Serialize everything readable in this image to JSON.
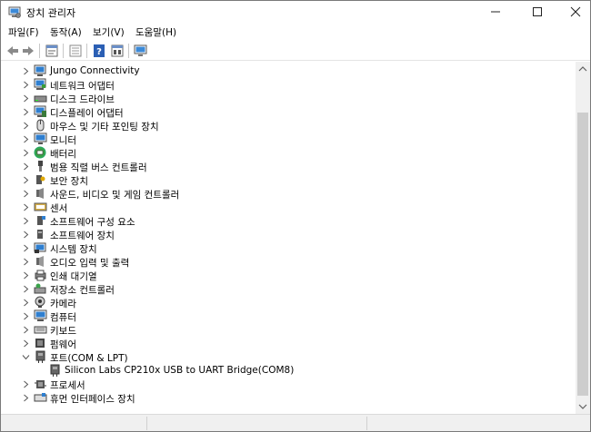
{
  "window": {
    "title": "장치 관리자",
    "controls": {
      "minimize": "—",
      "maximize": "☐",
      "close": "✕"
    }
  },
  "menubar": [
    {
      "label": "파일(F)"
    },
    {
      "label": "동작(A)"
    },
    {
      "label": "보기(V)"
    },
    {
      "label": "도움말(H)"
    }
  ],
  "toolbar": [
    {
      "icon": "back-arrow-icon"
    },
    {
      "icon": "forward-arrow-icon"
    },
    {
      "icon": "properties-icon"
    },
    {
      "icon": "show-hidden-icon"
    },
    {
      "icon": "help-icon"
    },
    {
      "icon": "update-driver-icon"
    },
    {
      "icon": "scan-hardware-icon"
    }
  ],
  "tree": [
    {
      "label": "Jungo Connectivity",
      "icon": "monitor-network-icon",
      "expanded": false
    },
    {
      "label": "네트워크 어댑터",
      "icon": "network-adapter-icon",
      "expanded": false
    },
    {
      "label": "디스크 드라이브",
      "icon": "disk-drive-icon",
      "expanded": false
    },
    {
      "label": "디스플레이 어댑터",
      "icon": "display-adapter-icon",
      "expanded": false
    },
    {
      "label": "마우스 및 기타 포인팅 장치",
      "icon": "mouse-icon",
      "expanded": false
    },
    {
      "label": "모니터",
      "icon": "monitor-icon",
      "expanded": false
    },
    {
      "label": "배터리",
      "icon": "battery-icon",
      "expanded": false
    },
    {
      "label": "범용 직렬 버스 컨트롤러",
      "icon": "usb-icon",
      "expanded": false
    },
    {
      "label": "보안 장치",
      "icon": "security-key-icon",
      "expanded": false
    },
    {
      "label": "사운드, 비디오 및 게임 컨트롤러",
      "icon": "speaker-icon",
      "expanded": false
    },
    {
      "label": "센서",
      "icon": "sensor-icon",
      "expanded": false
    },
    {
      "label": "소프트웨어 구성 요소",
      "icon": "software-component-icon",
      "expanded": false
    },
    {
      "label": "소프트웨어 장치",
      "icon": "software-device-icon",
      "expanded": false
    },
    {
      "label": "시스템 장치",
      "icon": "system-device-icon",
      "expanded": false
    },
    {
      "label": "오디오 입력 및 출력",
      "icon": "audio-icon",
      "expanded": false
    },
    {
      "label": "인쇄 대기열",
      "icon": "printer-icon",
      "expanded": false
    },
    {
      "label": "저장소 컨트롤러",
      "icon": "storage-controller-icon",
      "expanded": false
    },
    {
      "label": "카메라",
      "icon": "camera-icon",
      "expanded": false
    },
    {
      "label": "컴퓨터",
      "icon": "computer-icon",
      "expanded": false
    },
    {
      "label": "키보드",
      "icon": "keyboard-icon",
      "expanded": false
    },
    {
      "label": "펌웨어",
      "icon": "firmware-icon",
      "expanded": false
    },
    {
      "label": "포트(COM & LPT)",
      "icon": "port-icon",
      "expanded": true
    },
    {
      "label": "Silicon Labs CP210x USB to UART Bridge(COM8)",
      "icon": "port-icon",
      "child": true
    },
    {
      "label": "프로세서",
      "icon": "processor-icon",
      "expanded": false
    },
    {
      "label": "휴먼 인터페이스 장치",
      "icon": "hid-icon",
      "expanded": false
    }
  ],
  "colors": {
    "selection": "#cce8ff",
    "icon_blue": "#1e73be",
    "icon_gray": "#6d6d6d",
    "icon_dark": "#3a3a3a",
    "chevron": "#555555"
  }
}
